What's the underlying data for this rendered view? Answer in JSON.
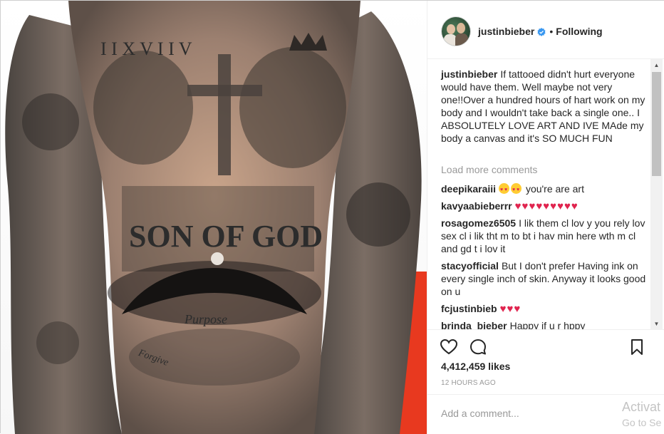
{
  "post": {
    "image_alt_texts": {
      "roman_numerals": "I I X V I I V",
      "chest_banner": "SON OF GOD",
      "stomach_script": "Purpose",
      "hip_script": "Forgive"
    },
    "author": {
      "username": "justinbieber",
      "verified": true,
      "follow_state": "Following",
      "separator": "•"
    },
    "caption": {
      "username": "justinbieber",
      "text": "If tattooed didn't hurt everyone would have them. Well maybe not very one!!Over a hundred hours of hart work on my body and I wouldn't take back a single one.. I ABSOLUTELY LOVE ART AND IVE MAde my body a canvas and it's SO MUCH FUN"
    },
    "load_more_label": "Load more comments",
    "comments": [
      {
        "username": "deepikaraiii",
        "text": "you're are art"
      },
      {
        "username": "kavyaabieberrr",
        "text": "♥♥♥♥♥♥♥♥♥"
      },
      {
        "username": "rosagomez6505",
        "text": "I lik them cl lov y you rely lov sex cl i lik tht m to bt i hav min here wth m cl and gd t i lov it"
      },
      {
        "username": "stacyofficial",
        "text": "But I don't prefer Having ink on every single inch of skin. Anyway it looks good on u"
      },
      {
        "username": "fcjustinbieb",
        "text": "♥♥♥"
      },
      {
        "username": "brinda_bieber",
        "text": "Happy if u r hppy"
      }
    ],
    "likes": "4,412,459 likes",
    "timestamp": "12 HOURS AGO",
    "add_comment_placeholder": "Add a comment...",
    "icons": {
      "like": "heart-outline-icon",
      "comment": "speech-bubble-icon",
      "save": "bookmark-icon",
      "verified": "verified-badge-icon"
    },
    "colors": {
      "verified_blue": "#3897f0",
      "muted": "#999999",
      "text": "#262626",
      "heart_red": "#e0244e",
      "photo_background_red": "#e8391f"
    }
  },
  "os_overlay": {
    "watermark_line1": "Activat",
    "watermark_line2": "Go to Se"
  }
}
